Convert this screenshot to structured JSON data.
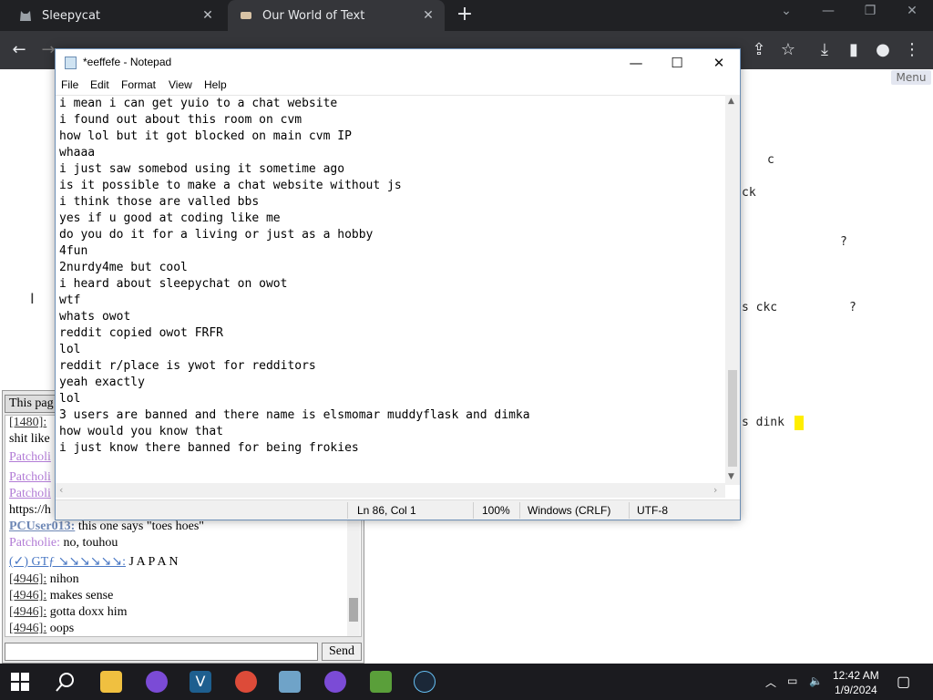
{
  "browser": {
    "tabs": [
      {
        "label": "Sleepycat"
      },
      {
        "label": "Our World of Text"
      }
    ]
  },
  "page": {
    "menu_label": "Menu",
    "owot_fragments": [
      "c",
      "ck",
      "?",
      "s ckc",
      "?",
      "s dink"
    ]
  },
  "chat": {
    "tab_label": "This pag",
    "lines": [
      {
        "user": "[1480]:",
        "text": ""
      },
      {
        "user": "",
        "text": "shit like"
      },
      {
        "user": "Patcholi",
        "text": ""
      },
      {
        "user": "Patcholi",
        "text": ""
      },
      {
        "user": "Patcholi",
        "text": ""
      },
      {
        "user": "",
        "text": "https://h"
      },
      {
        "user": "PCUser013:",
        "text": " this one says \"toes hoes\""
      },
      {
        "user": "Patcholie:",
        "text": " no, touhou"
      },
      {
        "user": "(✓) GTƒ ↘↘↘↘↘↘:",
        "text": " J A P A N"
      },
      {
        "user": "[4946]:",
        "text": " nihon"
      },
      {
        "user": "[4946]:",
        "text": " makes sense"
      },
      {
        "user": "[4946]:",
        "text": " gotta doxx him"
      },
      {
        "user": "[4946]:",
        "text": " oops"
      }
    ],
    "send_label": "Send"
  },
  "notepad": {
    "title": "*eeffefe - Notepad",
    "menu": [
      "File",
      "Edit",
      "Format",
      "View",
      "Help"
    ],
    "lines": [
      "i mean i can get yuio to a chat website",
      "i found out about this room on cvm",
      "how lol but it got blocked on main cvm IP",
      "whaaa",
      "i just saw somebod using it sometime ago",
      "is it possible to make a chat website without js",
      "i think those are valled bbs",
      "yes if u good at coding like me",
      "do you do it for a living or just as a hobby",
      "4fun",
      "2nurdy4me but cool",
      "i heard about sleepychat on owot",
      "wtf",
      "whats owot",
      "reddit copied owot FRFR",
      "lol",
      "reddit r/place is ywot for redditors",
      "yeah exactly",
      "lol",
      "3 users are banned and there name is elsmomar muddyflask and dimka",
      "how would you know that",
      "i just know there banned for being frokies"
    ],
    "status": {
      "position": "Ln 86, Col 1",
      "zoom": "100%",
      "line_endings": "Windows (CRLF)",
      "encoding": "UTF-8"
    }
  },
  "taskbar": {
    "time": "12:42 AM",
    "date": "1/9/2024"
  }
}
